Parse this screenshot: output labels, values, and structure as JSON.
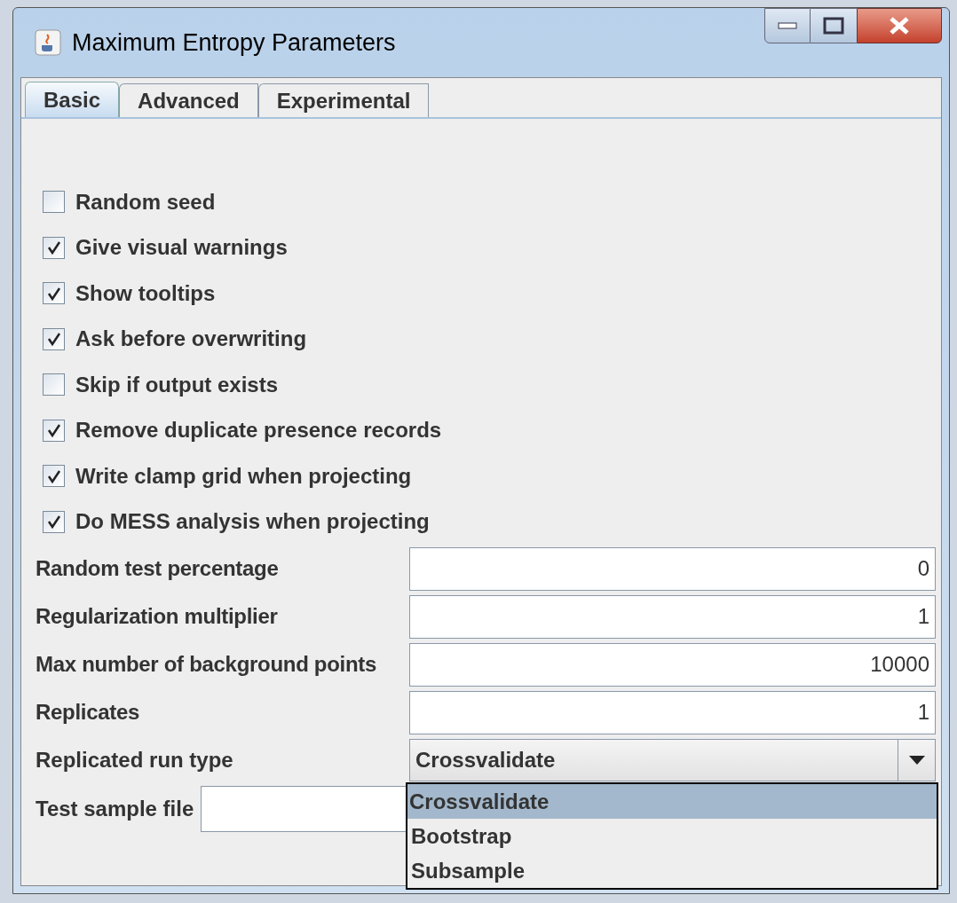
{
  "window": {
    "title": "Maximum Entropy Parameters"
  },
  "tabs": [
    {
      "label": "Basic",
      "selected": true
    },
    {
      "label": "Advanced",
      "selected": false
    },
    {
      "label": "Experimental",
      "selected": false
    }
  ],
  "checkboxes": [
    {
      "label": "Random seed",
      "checked": false
    },
    {
      "label": "Give visual warnings",
      "checked": true
    },
    {
      "label": "Show tooltips",
      "checked": true
    },
    {
      "label": "Ask before overwriting",
      "checked": true
    },
    {
      "label": "Skip if output exists",
      "checked": false
    },
    {
      "label": "Remove duplicate presence records",
      "checked": true
    },
    {
      "label": "Write clamp grid when projecting",
      "checked": true
    },
    {
      "label": "Do MESS analysis when projecting",
      "checked": true
    }
  ],
  "fields": [
    {
      "label": "Random test percentage",
      "value": "0"
    },
    {
      "label": "Regularization multiplier",
      "value": "1"
    },
    {
      "label": "Max number of background points",
      "value": "10000"
    },
    {
      "label": "Replicates",
      "value": "1"
    }
  ],
  "run_type": {
    "label": "Replicated run type",
    "value": "Crossvalidate",
    "expanded": true,
    "options": [
      {
        "label": "Crossvalidate",
        "selected": true
      },
      {
        "label": "Bootstrap",
        "selected": false
      },
      {
        "label": "Subsample",
        "selected": false
      }
    ]
  },
  "test_sample_file": {
    "label": "Test sample file"
  }
}
